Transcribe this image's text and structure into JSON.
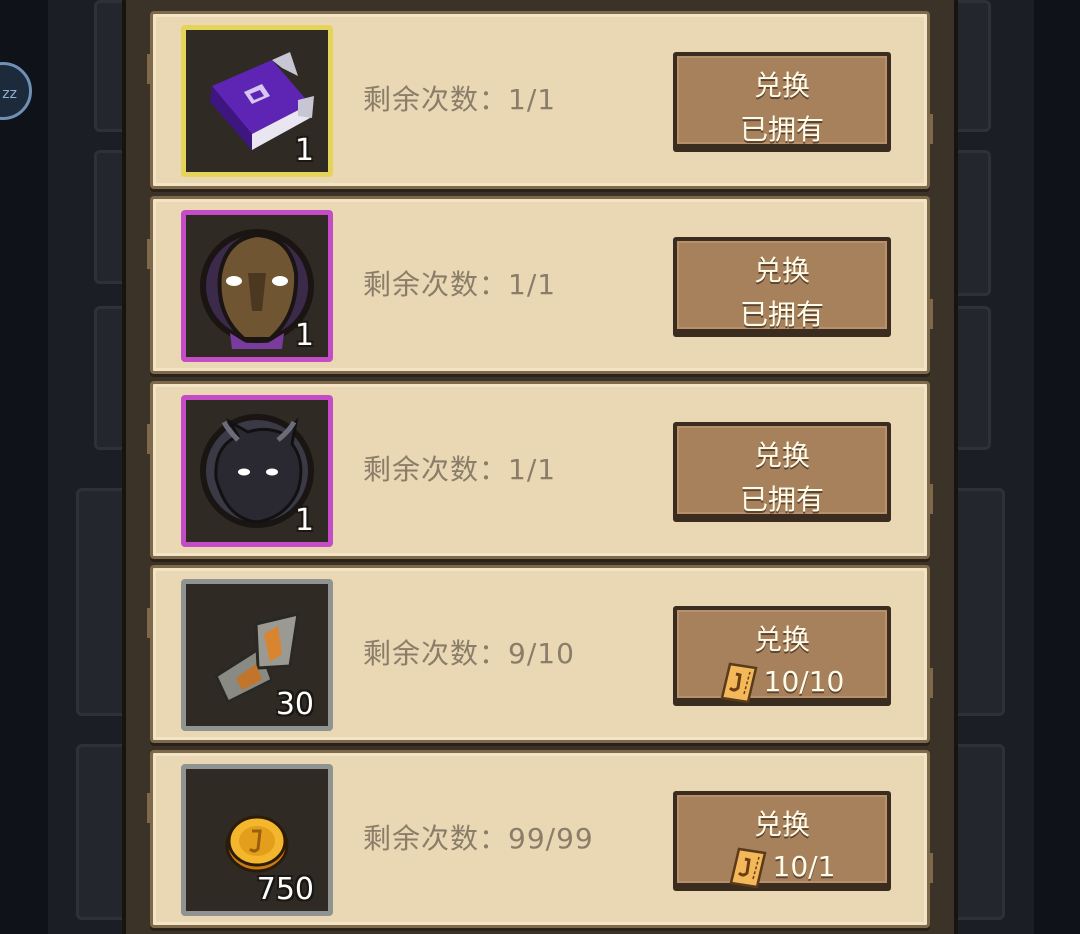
{
  "background": {
    "badge_text": "zz"
  },
  "items": [
    {
      "icon": "purple-book-icon",
      "rarity_color": "#e5d35a",
      "quantity": "1",
      "remaining_label": "剩余次数：1/1",
      "button_title": "兑换",
      "button_status": "已拥有",
      "cost_icon": null
    },
    {
      "icon": "masked-hero-portrait-icon",
      "rarity_color": "#c44dc7",
      "quantity": "1",
      "remaining_label": "剩余次数：1/1",
      "button_title": "兑换",
      "button_status": "已拥有",
      "cost_icon": null
    },
    {
      "icon": "dark-beast-portrait-icon",
      "rarity_color": "#c44dc7",
      "quantity": "1",
      "remaining_label": "剩余次数：1/1",
      "button_title": "兑换",
      "button_status": "已拥有",
      "cost_icon": null
    },
    {
      "icon": "map-scroll-icon",
      "rarity_color": "#8f9391",
      "quantity": "30",
      "remaining_label": "剩余次数：9/10",
      "button_title": "兑换",
      "button_status": "10/10",
      "cost_icon": "ticket-icon"
    },
    {
      "icon": "gold-coin-icon",
      "rarity_color": "#8f9391",
      "quantity": "750",
      "remaining_label": "剩余次数：99/99",
      "button_title": "兑换",
      "button_status": "10/1",
      "cost_icon": "ticket-icon"
    }
  ]
}
